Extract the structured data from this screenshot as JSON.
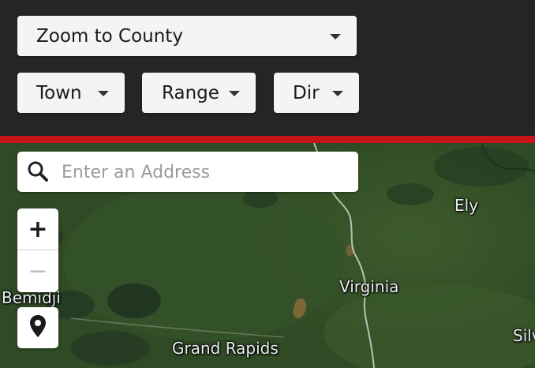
{
  "header": {
    "county_select": "Zoom to County",
    "town_select": "Town",
    "range_select": "Range",
    "dir_select": "Dir"
  },
  "search": {
    "placeholder": "Enter an Address"
  },
  "zoom": {
    "in_label": "+",
    "out_label": "−"
  },
  "map": {
    "labels": {
      "ely": "Ely",
      "virginia": "Virginia",
      "bemidji": "Bemidji",
      "grand_rapids": "Grand Rapids",
      "silver": "Silv"
    }
  },
  "icons": {
    "search": "search-icon",
    "caret": "chevron-down-icon",
    "locate": "map-marker-icon"
  },
  "colors": {
    "accent_line": "#c8151b",
    "header_bg": "#252525"
  }
}
